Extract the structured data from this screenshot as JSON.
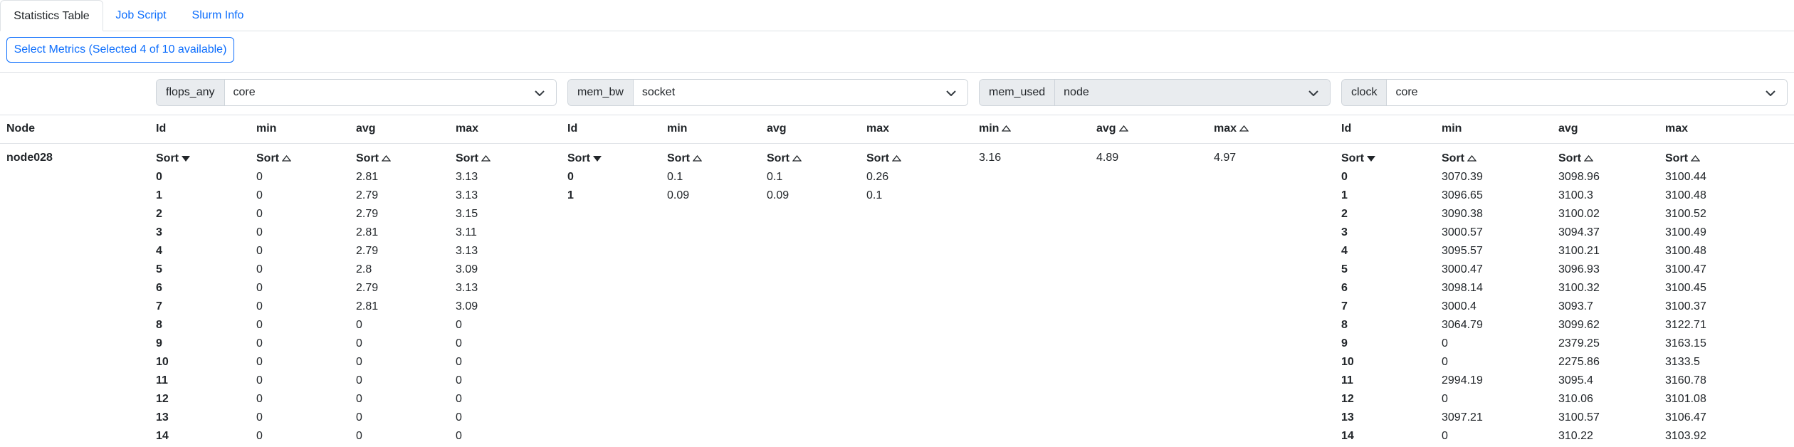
{
  "tabs": [
    {
      "label": "Statistics Table",
      "active": true
    },
    {
      "label": "Job Script",
      "active": false
    },
    {
      "label": "Slurm Info",
      "active": false
    }
  ],
  "metrics_button": {
    "label": "Select Metrics (Selected 4 of 10 available)"
  },
  "node_header": "Node",
  "node_name": "node028",
  "sort_label": "Sort",
  "metrics": [
    {
      "name": "flops_any",
      "scope": "core",
      "disabled": false,
      "columns": [
        "Id",
        "min",
        "avg",
        "max"
      ],
      "rows": [
        [
          "0",
          "0",
          "2.81",
          "3.13"
        ],
        [
          "1",
          "0",
          "2.79",
          "3.13"
        ],
        [
          "2",
          "0",
          "2.79",
          "3.15"
        ],
        [
          "3",
          "0",
          "2.81",
          "3.11"
        ],
        [
          "4",
          "0",
          "2.79",
          "3.13"
        ],
        [
          "5",
          "0",
          "2.8",
          "3.09"
        ],
        [
          "6",
          "0",
          "2.79",
          "3.13"
        ],
        [
          "7",
          "0",
          "2.81",
          "3.09"
        ],
        [
          "8",
          "0",
          "0",
          "0"
        ],
        [
          "9",
          "0",
          "0",
          "0"
        ],
        [
          "10",
          "0",
          "0",
          "0"
        ],
        [
          "11",
          "0",
          "0",
          "0"
        ],
        [
          "12",
          "0",
          "0",
          "0"
        ],
        [
          "13",
          "0",
          "0",
          "0"
        ],
        [
          "14",
          "0",
          "0",
          "0"
        ]
      ]
    },
    {
      "name": "mem_bw",
      "scope": "socket",
      "disabled": false,
      "columns": [
        "Id",
        "min",
        "avg",
        "max"
      ],
      "rows": [
        [
          "0",
          "0.1",
          "0.1",
          "0.26"
        ],
        [
          "1",
          "0.09",
          "0.09",
          "0.1"
        ]
      ]
    },
    {
      "name": "mem_used",
      "scope": "node",
      "disabled": true,
      "columns": [
        "min",
        "avg",
        "max"
      ],
      "values": [
        "3.16",
        "4.89",
        "4.97"
      ]
    },
    {
      "name": "clock",
      "scope": "core",
      "disabled": false,
      "columns": [
        "Id",
        "min",
        "avg",
        "max"
      ],
      "rows": [
        [
          "0",
          "3070.39",
          "3098.96",
          "3100.44"
        ],
        [
          "1",
          "3096.65",
          "3100.3",
          "3100.48"
        ],
        [
          "2",
          "3090.38",
          "3100.02",
          "3100.52"
        ],
        [
          "3",
          "3000.57",
          "3094.37",
          "3100.49"
        ],
        [
          "4",
          "3095.57",
          "3100.21",
          "3100.48"
        ],
        [
          "5",
          "3000.47",
          "3096.93",
          "3100.47"
        ],
        [
          "6",
          "3098.14",
          "3100.32",
          "3100.45"
        ],
        [
          "7",
          "3000.4",
          "3093.7",
          "3100.37"
        ],
        [
          "8",
          "3064.79",
          "3099.62",
          "3122.71"
        ],
        [
          "9",
          "0",
          "2379.25",
          "3163.15"
        ],
        [
          "10",
          "0",
          "2275.86",
          "3133.5"
        ],
        [
          "11",
          "2994.19",
          "3095.4",
          "3160.78"
        ],
        [
          "12",
          "0",
          "310.06",
          "3101.08"
        ],
        [
          "13",
          "3097.21",
          "3100.57",
          "3106.47"
        ],
        [
          "14",
          "0",
          "310.22",
          "3103.92"
        ]
      ]
    }
  ],
  "icons": {
    "sort_desc": "caret-down-icon",
    "sort_asc": "caret-up-outline-icon",
    "dropdown": "chevron-down-icon"
  },
  "colors": {
    "accent": "#0d6efd",
    "border": "#dee2e6",
    "input_border": "#ced4da",
    "addon_bg": "#e9ecef"
  }
}
